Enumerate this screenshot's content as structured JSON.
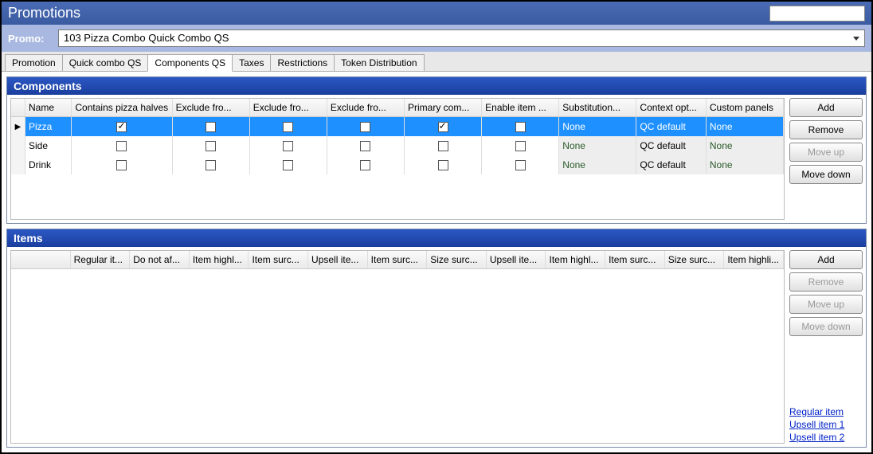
{
  "window": {
    "title": "Promotions"
  },
  "promo": {
    "label": "Promo:",
    "value": "103 Pizza Combo Quick Combo QS"
  },
  "tabs": [
    {
      "label": "Promotion"
    },
    {
      "label": "Quick combo QS"
    },
    {
      "label": "Components QS",
      "active": true
    },
    {
      "label": "Taxes"
    },
    {
      "label": "Restrictions"
    },
    {
      "label": "Token Distribution"
    }
  ],
  "components": {
    "title": "Components",
    "columns": [
      "Name",
      "Contains pizza halves",
      "Exclude fro...",
      "Exclude fro...",
      "Exclude fro...",
      "Primary com...",
      "Enable item ...",
      "Substitution...",
      "Context opt...",
      "Custom panels"
    ],
    "rows": [
      {
        "name": "Pizza",
        "halves": true,
        "ex1": false,
        "ex2": false,
        "ex3": false,
        "primary": true,
        "enable": false,
        "sub": "None",
        "ctx": "QC default",
        "panels": "None",
        "selected": true
      },
      {
        "name": "Side",
        "halves": false,
        "ex1": false,
        "ex2": false,
        "ex3": false,
        "primary": false,
        "enable": false,
        "sub": "None",
        "ctx": "QC default",
        "panels": "None",
        "selected": false
      },
      {
        "name": "Drink",
        "halves": false,
        "ex1": false,
        "ex2": false,
        "ex3": false,
        "primary": false,
        "enable": false,
        "sub": "None",
        "ctx": "QC default",
        "panels": "None",
        "selected": false
      }
    ],
    "buttons": {
      "add": "Add",
      "remove": "Remove",
      "moveup": "Move up",
      "movedown": "Move down"
    }
  },
  "items": {
    "title": "Items",
    "columns": [
      "Regular it...",
      "Do not af...",
      "Item highl...",
      "Item surc...",
      "Upsell ite...",
      "Item surc...",
      "Size surc...",
      "Upsell ite...",
      "Item highl...",
      "Item surc...",
      "Size surc...",
      "Item highli..."
    ],
    "buttons": {
      "add": "Add",
      "remove": "Remove",
      "moveup": "Move up",
      "movedown": "Move down"
    },
    "links": [
      "Regular item",
      "Upsell item 1",
      "Upsell item 2"
    ]
  }
}
